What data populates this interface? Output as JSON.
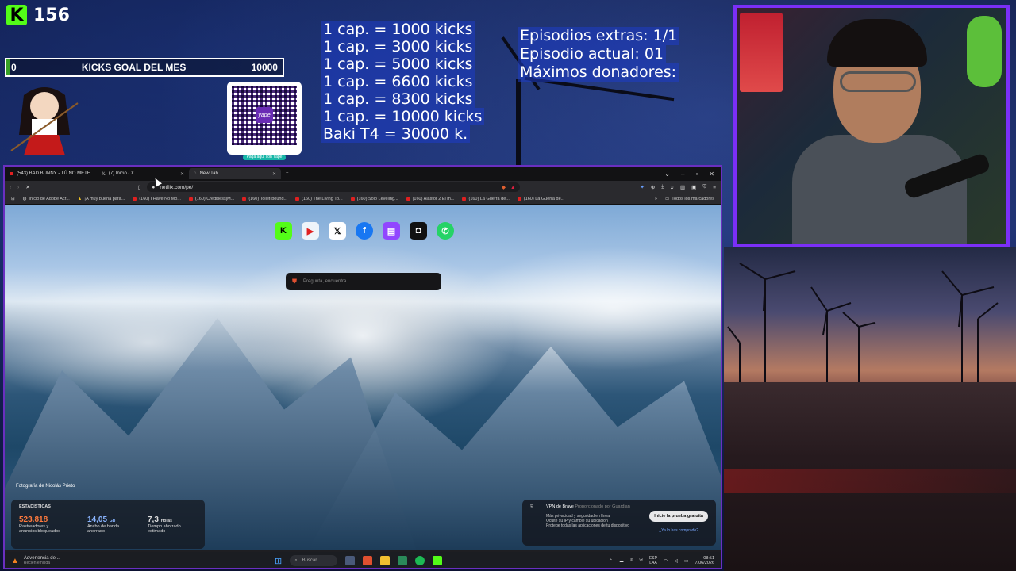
{
  "overlay": {
    "kick_count": "156",
    "kick_logo": "K",
    "goal": {
      "start": "0",
      "label": "KICKS GOAL DEL MES",
      "target": "10000",
      "progress": 0.0156
    },
    "qr_brand": "yape",
    "qr_caption": "Paga aquí con Yape",
    "caps": [
      "1 cap. = 1000 kicks",
      "1 cap. = 3000 kicks",
      "1 cap. = 5000 kicks",
      "1 cap. = 6600 kicks",
      "1 cap. = 8300 kicks",
      "1 cap. = 10000 kicks",
      "Baki T4 = 30000 k."
    ],
    "episodes": [
      "Episodios extras: 1/1",
      "Episodio actual: 01",
      "Máximos donadores:"
    ]
  },
  "browser": {
    "tabs": [
      {
        "label": "(543) BAD BUNNY - TÚ NO METE"
      },
      {
        "label": "(7) Inicio / X"
      },
      {
        "label": "New Tab"
      }
    ],
    "new_tab": "+",
    "url": "netflix.com/pe/",
    "bookmarks": [
      "Inicio de Adobe Acr...",
      "¡A muy buena para...",
      "(160) I Have No Mo...",
      "(160) Creditless|M...",
      "(160) Toilet-bound...",
      "(160) The Living To...",
      "(160) Solo Leveling...",
      "(160) Alastor 2 El m...",
      "(160) La Guerra de...",
      "(160) La Guerra de..."
    ],
    "all_bookmarks": "Todos los marcadores",
    "shortcut_icons": [
      "kick-icon",
      "youtube-icon",
      "x-icon",
      "facebook-icon",
      "twitch-icon",
      "kick-alt-icon",
      "whatsapp-icon"
    ],
    "search_placeholder": "Pregunta, encuentra...",
    "photo_credit": "Fotografía de Nicolás Prieto",
    "stats": {
      "title": "ESTADÍSTICAS",
      "trackers_value": "523.818",
      "trackers_label": "Rastreadores y anuncios bloqueados",
      "bandwidth_value": "14,05",
      "bandwidth_unit": "GB",
      "bandwidth_label": "Ancho de banda ahorrado",
      "time_value": "7,3",
      "time_unit": "Horas",
      "time_label": "Tiempo ahorrado estimado"
    },
    "vpn": {
      "title": "VPN de Brave",
      "sponsor": "Proporcionado por Guardian",
      "lines": [
        "Más privacidad y seguridad en línea",
        "Oculte su IP y cambie su ubicación",
        "Protege todas las aplicaciones de tu dispositivo"
      ],
      "cta": "Inicie la prueba gratuita",
      "link": "¿Ya lo has comprado?"
    }
  },
  "taskbar": {
    "alert_title": "Advertencia de...",
    "alert_sub": "Recién emitida",
    "search": "Buscar",
    "lang": "ESP",
    "lang_sub": "LAA",
    "time": "08:51",
    "date": "7/06/2026"
  },
  "colors": {
    "kick_green": "#53fc18",
    "frame_purple": "#7b2ff7",
    "caps_bg": "#1e3cc8"
  }
}
